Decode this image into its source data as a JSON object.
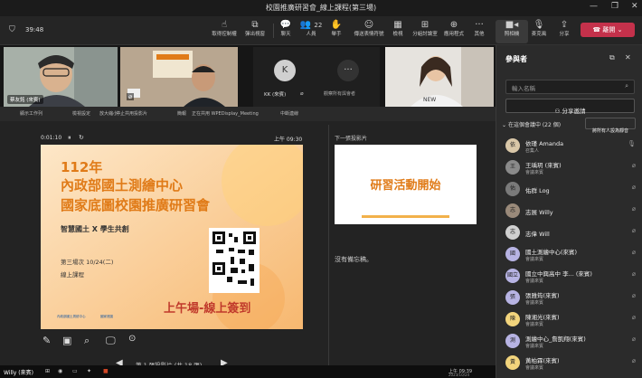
{
  "window": {
    "title": "校園推廣研習會_線上課程(第三場)"
  },
  "toolbar": {
    "timer": "39:48",
    "buttons": [
      {
        "label": "取得控制權",
        "icon": "control-icon"
      },
      {
        "label": "彈出視窗",
        "icon": "popout-icon"
      },
      {
        "label": "聊天",
        "icon": "chat-icon"
      },
      {
        "label": "人員",
        "icon": "people-icon",
        "count": "22"
      },
      {
        "label": "舉手",
        "icon": "raise-hand-icon"
      },
      {
        "label": "傳送表情符號",
        "icon": "reaction-icon"
      },
      {
        "label": "檢視",
        "icon": "view-icon"
      },
      {
        "label": "分組討論室",
        "icon": "breakout-icon"
      },
      {
        "label": "應用程式",
        "icon": "apps-icon"
      },
      {
        "label": "其他",
        "icon": "more-icon"
      },
      {
        "label": "照相機",
        "icon": "camera-icon"
      },
      {
        "label": "麥克風",
        "icon": "mic-icon"
      },
      {
        "label": "分享",
        "icon": "share-icon"
      }
    ],
    "leave_label": "離開"
  },
  "videos": [
    {
      "name": "蔡友銘 (來賓)"
    },
    {
      "name": ""
    },
    {
      "name": "KK (來賓)",
      "initial": "K"
    },
    {
      "name": "觀察所有與會者"
    },
    {
      "name": ""
    }
  ],
  "share_strip": {
    "items": [
      "顯示工作列",
      "檢視設定",
      "放大縮小",
      "停止共用投影片",
      "簡報",
      "正在共用 WPEDisplay_Meeting",
      "中斷連線"
    ]
  },
  "presenter": {
    "elapsed": "0:01:10",
    "clock": "上午 09:30",
    "next_label": "下一張投影片",
    "notes": "沒有備忘稿。",
    "slide_counter": "第 1 張投影片 (共 18 張)",
    "slide": {
      "year": "112年",
      "line1": "內政部國土測繪中心",
      "line2": "國家底圖校園推廣研習會",
      "tagline": "智慧國土 X 學生共創",
      "session": "第三場次 10/24(二)",
      "mode": "線上課程",
      "signin": "上午場-線上簽到",
      "logo1": "內政部國土測繪中心",
      "logo2": "國家底圖"
    },
    "next_slide": {
      "title": "研習活動開始"
    }
  },
  "panel": {
    "title": "參與者",
    "search_placeholder": "輸入名稱",
    "share_invite": "分享邀請",
    "section_label": "在這個會議中 (22 個)",
    "mute_all": "將所有人設為靜音",
    "participants": [
      {
        "name": "依瑾 Amanda",
        "role": "召集人",
        "initial": "依",
        "color": "#d9c7a8"
      },
      {
        "name": "王瑀玥 (來賓)",
        "role": "會議來賓",
        "initial": "王",
        "color": "#8a8a8a"
      },
      {
        "name": "佑群 Log",
        "role": "",
        "initial": "佑",
        "color": "#7a7a7a"
      },
      {
        "name": "志展 Willy",
        "role": "",
        "initial": "志",
        "color": "#9a8a7a"
      },
      {
        "name": "志偉 Will",
        "role": "",
        "initial": "志",
        "color": "#d0d0d0"
      },
      {
        "name": "國土測繪中心(來賓)",
        "role": "會議來賓",
        "initial": "國",
        "color": "#b7b3e3"
      },
      {
        "name": "國立中興高中 李... (來賓)",
        "role": "會議來賓",
        "initial": "國立",
        "color": "#b7b3e3"
      },
      {
        "name": "張雅筠(來賓)",
        "role": "會議來賓",
        "initial": "張",
        "color": "#b7b3e3"
      },
      {
        "name": "陳湘光(來賓)",
        "role": "會議來賓",
        "initial": "陳",
        "color": "#f2d47c"
      },
      {
        "name": "測繪中心_詹凱翔(來賓)",
        "role": "會議來賓",
        "initial": "測",
        "color": "#b7b3e3"
      },
      {
        "name": "黃柏霖(來賓)",
        "role": "會議來賓",
        "initial": "黃",
        "color": "#f2d47c"
      }
    ]
  },
  "taskbar": {
    "user": "Willy (來賓)",
    "time": "上午 09:39",
    "date": "2023/10/24"
  },
  "colors": {
    "accent": "#6264a7",
    "leave": "#c4314b",
    "slide_title": "#c0392b",
    "slide_orange": "#e07b18"
  }
}
